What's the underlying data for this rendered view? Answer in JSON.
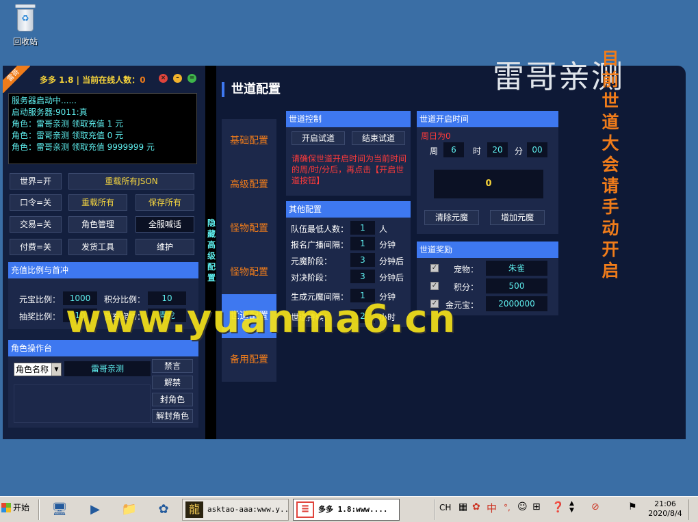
{
  "desktop": {
    "recycle_bin_label": "回收站",
    "overlay_title": "雷哥亲测",
    "side_notice": "目前世道大会请手动开启",
    "watermark": "www.yuanma6.cn"
  },
  "left": {
    "ribbon": "雷哥",
    "title": "多多 1.8 | 当前在线人数：",
    "online_count": "0",
    "log": [
      "服务器启动中......",
      "启动服务器:9011:真",
      "角色：雷哥亲测 领取充值 1 元",
      "角色：雷哥亲测 领取充值 0 元",
      "角色：雷哥亲测 领取充值 9999999 元"
    ],
    "buttons": {
      "world": "世界=开",
      "reload_json": "重载所有JSON",
      "command": "口令=关",
      "reload_all": "重载所有",
      "save_all": "保存所有",
      "trade": "交易=关",
      "role_mgmt": "角色管理",
      "broadcast": "全服喊话",
      "paid": "付费=关",
      "ship_tool": "发货工具",
      "maintain": "维护"
    },
    "recharge": {
      "header": "充值比例与首冲",
      "yuanbao_label": "元宝比例：",
      "yuanbao_value": "1000",
      "points_label": "积分比例：",
      "points_value": "10",
      "lottery_label": "抽奖比例：",
      "lottery_value": "10",
      "first_label": "首充宠物：",
      "first_value": "青龙"
    },
    "role_console": {
      "header": "角色操作台",
      "select_value": "角色名称",
      "input_value": "雷哥亲测",
      "mute": "禁言",
      "unmute": "解禁",
      "ban": "封角色",
      "unban": "解封角色"
    },
    "hidden_config": "隐藏高级配置"
  },
  "main": {
    "page_title": "世道配置",
    "nav": [
      "基础配置",
      "高级配置",
      "怪物配置",
      "怪物配置",
      "世道配置",
      "备用配置"
    ],
    "control": {
      "header": "世道控制",
      "start_trial": "开启试道",
      "end_trial": "结束试道",
      "warning": "请确保世道开启时间为当前时间的周/时/分后，再点击【开启世道按钮】"
    },
    "other": {
      "header": "其他配置",
      "rows": [
        {
          "label": "队伍最低人数：",
          "value": "1",
          "unit": "人"
        },
        {
          "label": "报名广播间隔：",
          "value": "1",
          "unit": "分钟"
        },
        {
          "label": "元魔阶段：",
          "value": "3",
          "unit": "分钟后"
        },
        {
          "label": "对决阶段：",
          "value": "3",
          "unit": "分钟后"
        },
        {
          "label": "生成元魔间隔：",
          "value": "1",
          "unit": "分钟"
        },
        {
          "label": "世道持续：",
          "value": "2",
          "unit": "小时"
        }
      ]
    },
    "open_time": {
      "header": "世道开启时间",
      "sunday_note": "周日为0",
      "week_label": "周",
      "week_value": "6",
      "hour_label": "时",
      "hour_value": "20",
      "minute_label": "分",
      "minute_value": "00",
      "count": "0",
      "clear_btn": "清除元魔",
      "add_btn": "增加元魔"
    },
    "rewards": {
      "header": "世道奖励",
      "pet_label": "宠物：",
      "pet_value": "朱雀",
      "points_label": "积分：",
      "points_value": "500",
      "gold_label": "金元宝：",
      "gold_value": "2000000"
    }
  },
  "taskbar": {
    "start": "开始",
    "task1": "asktao-aaa:www.y...",
    "task2": "多多 1.8:www....",
    "lang": "CH",
    "ime": "中",
    "time": "21:06",
    "date": "2020/8/4"
  }
}
